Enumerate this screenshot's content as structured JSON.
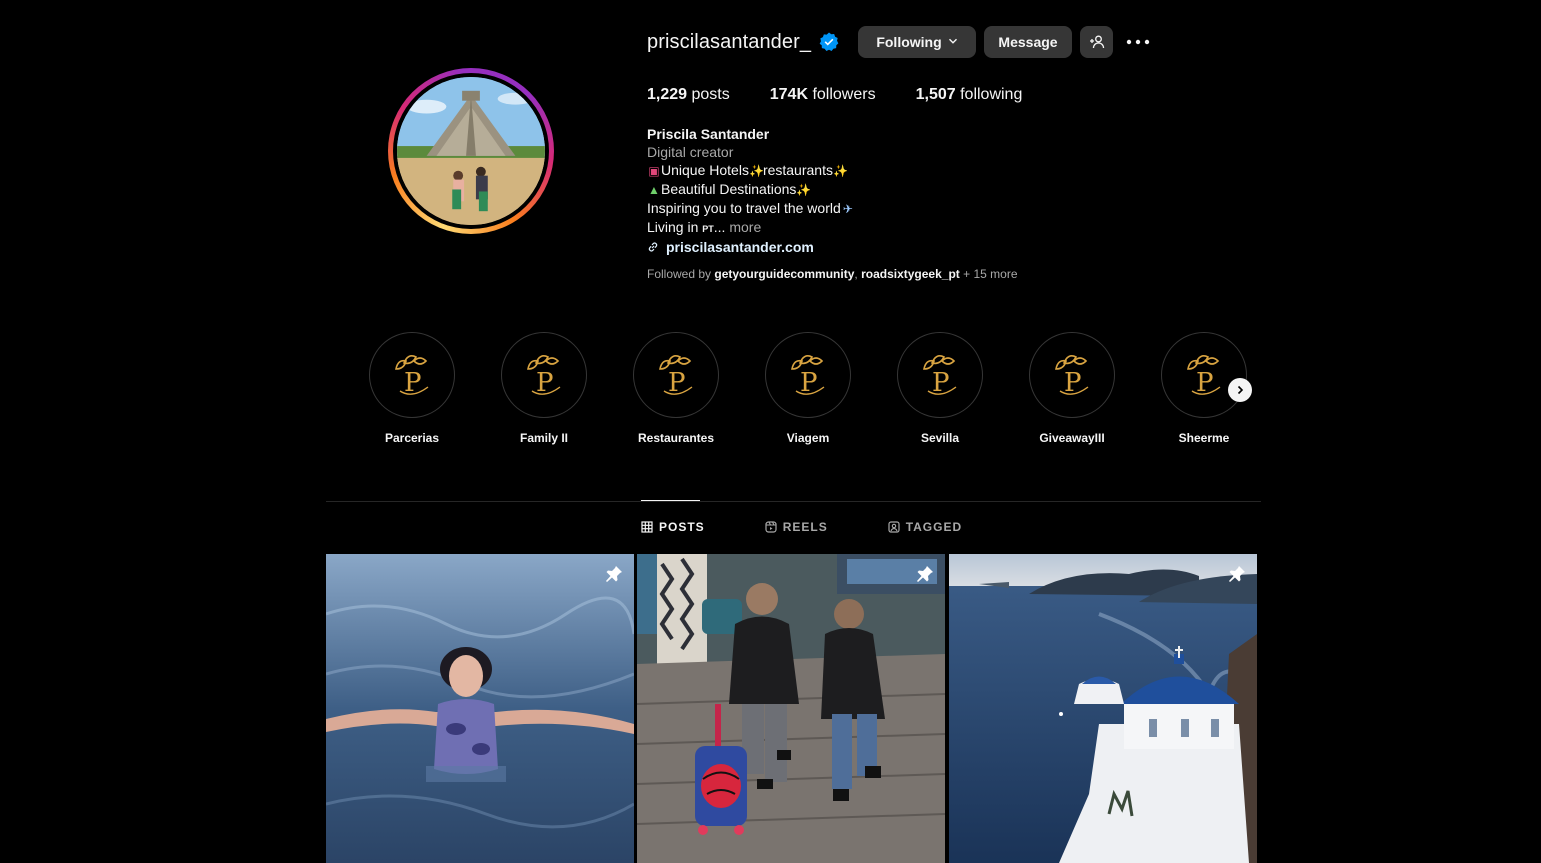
{
  "profile": {
    "username": "priscilasantander_",
    "buttons": {
      "following": "Following",
      "message": "Message"
    },
    "stats": {
      "posts_count": "1,229",
      "posts_label": "posts",
      "followers_count": "174K",
      "followers_label": "followers",
      "following_count": "1,507",
      "following_label": "following"
    },
    "bio": {
      "name": "Priscila Santander",
      "category": "Digital creator",
      "line1": "Unique Hotels",
      "line1b": "restaurants",
      "line2": "Beautiful Destinations",
      "line3": "Inspiring you to travel the world",
      "line4": "Living in",
      "line4_flag": "PT",
      "line4_ellipsis": "...",
      "more": "more",
      "link": "priscilasantander.com"
    },
    "followed_by": {
      "prefix": "Followed by",
      "user1": "getyourguidecommunity",
      "user2": "roadsixtygeek_pt",
      "suffix": "+ 15 more"
    }
  },
  "highlights": [
    {
      "label": "Parcerias"
    },
    {
      "label": "Family II"
    },
    {
      "label": "Restaurantes"
    },
    {
      "label": "Viagem"
    },
    {
      "label": "Sevilla"
    },
    {
      "label": "GiveawayIII"
    },
    {
      "label": "Sheerme"
    }
  ],
  "tabs": [
    {
      "label": "POSTS",
      "active": true
    },
    {
      "label": "REELS",
      "active": false
    },
    {
      "label": "TAGGED",
      "active": false
    }
  ],
  "posts": [
    {
      "pinned": true,
      "icon": "pin-icon"
    },
    {
      "pinned": true,
      "icon": "pin-icon"
    },
    {
      "pinned": true,
      "icon": "pin-icon"
    }
  ],
  "colors": {
    "background": "#000000",
    "button": "#363636",
    "verified": "#0095f6",
    "highlight_logo": "#d9a441"
  }
}
